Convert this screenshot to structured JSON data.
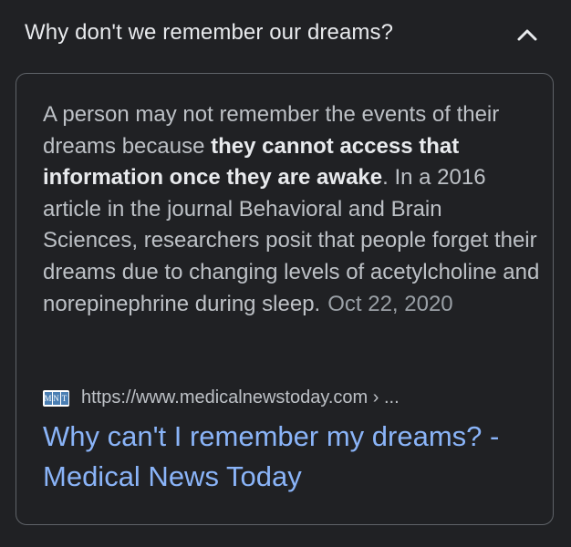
{
  "question": {
    "text": "Why don't we remember our dreams?",
    "expand_icon": "chevron-up-icon",
    "expanded": true
  },
  "answer": {
    "snippet_before": "A person may not remember the events of their dreams because ",
    "snippet_bold": "they cannot access that information once they are awake",
    "snippet_after": ". In a 2016 article in the journal Behavioral and Brain Sciences, researchers posit that people forget their dreams due to changing levels of acetylcholine and norepinephrine during sleep.",
    "date": "Oct 22, 2020"
  },
  "source": {
    "favicon_icon": "medical-news-today-favicon-icon",
    "favicon_letters": [
      "M",
      "N",
      "T"
    ],
    "url_display": "https://www.medicalnewstoday.com › ...",
    "title": "Why can't I remember my dreams? - Medical News Today"
  },
  "colors": {
    "background": "#202124",
    "text_primary": "#e8eaed",
    "text_secondary": "#bdc1c6",
    "text_muted": "#9aa0a6",
    "link": "#8ab4f8",
    "border": "#5f6368"
  }
}
